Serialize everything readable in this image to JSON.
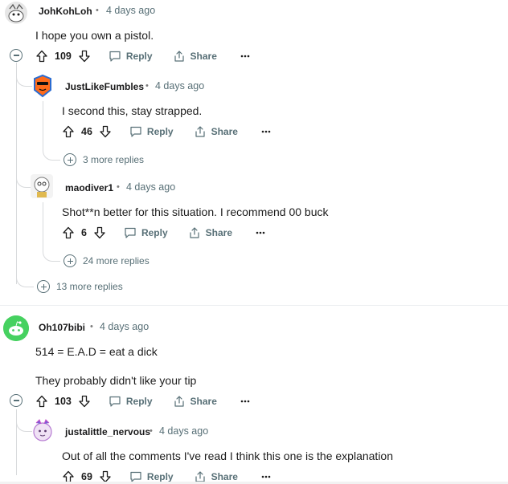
{
  "labels": {
    "reply": "Reply",
    "share": "Share",
    "separator": "•"
  },
  "comments": [
    {
      "user": "JohKohLoh",
      "time": "4 days ago",
      "body": "I hope you own a pistol.",
      "votes": "109"
    },
    {
      "user": "JustLikeFumbles",
      "time": "4 days ago",
      "body": "I second this, stay strapped.",
      "votes": "46",
      "more_replies": "3 more replies"
    },
    {
      "user": "maodiver1",
      "time": "4 days ago",
      "body": "Shot**n better for this situation. I recommend 00 buck",
      "votes": "6",
      "more_replies": "24 more replies"
    },
    {
      "more_replies": "13 more replies"
    },
    {
      "user": "Oh107bibi",
      "time": "4 days ago",
      "body": "514 = E.A.D = eat a dick",
      "body2": "They probably didn't like your tip",
      "votes": "103"
    },
    {
      "user": "justalittle_nervous",
      "time": "4 days ago",
      "body": "Out of all the comments I've read I think this one is the explanation",
      "votes": "69"
    }
  ],
  "colors": {
    "avatar_green": "#46d160",
    "avatar_blue": "#0079d3",
    "meta": "#576f76"
  }
}
